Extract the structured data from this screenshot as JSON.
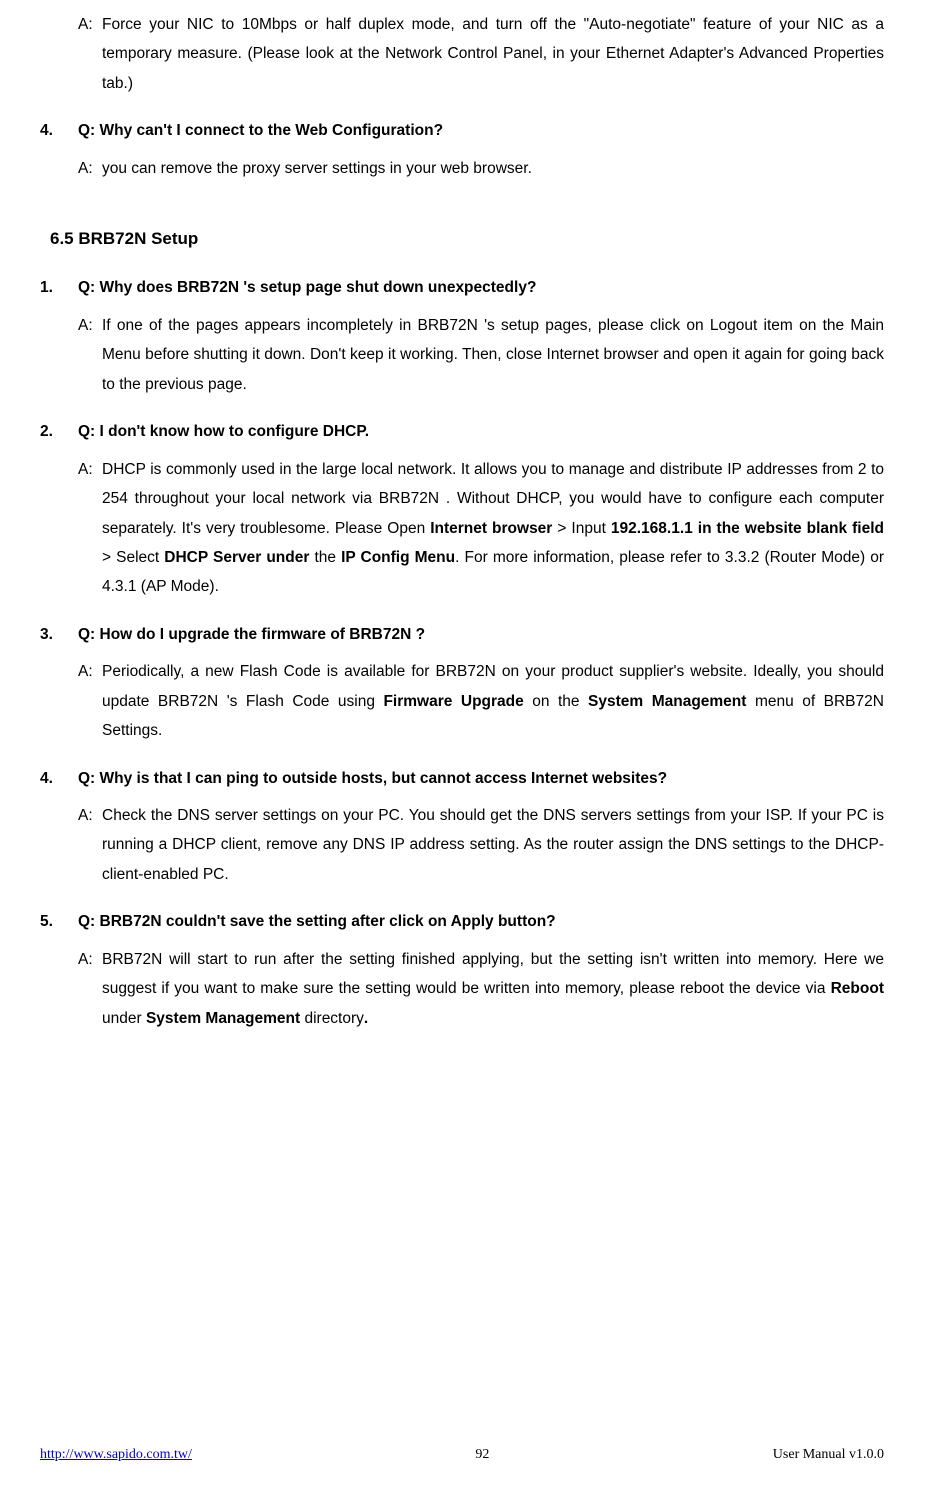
{
  "top": {
    "a_prefix": "A:",
    "a_text": "Force your NIC to 10Mbps or half duplex mode, and turn off the \"Auto-negotiate\" feature of your NIC as a temporary measure. (Please look at the Network Control Panel, in your Ethernet Adapter's Advanced Properties tab.)"
  },
  "q_top4": {
    "num": "4.",
    "q": "Q: Why can't I connect to the Web Configuration?",
    "a_prefix": "A:",
    "a_text": "you can remove the proxy server settings in your web browser."
  },
  "section": "6.5   BRB72N Setup",
  "q1": {
    "num": "1.",
    "q": "Q: Why does BRB72N 's setup page shut down unexpectedly?",
    "a_prefix": "A:",
    "a_text": "If one of the pages appears incompletely in BRB72N 's setup pages, please click on Logout item on the Main Menu before shutting it down. Don't keep it working. Then, close Internet browser and open it again for going back to the previous page."
  },
  "q2": {
    "num": "2.",
    "q": "Q:    I don't know how to configure DHCP.",
    "a_prefix": "A:",
    "a_pre": "DHCP is commonly used in the large local network. It allows you to manage and distribute IP addresses from 2 to 254 throughout your local network via BRB72N . Without DHCP, you would have to configure each computer separately. It's very troublesome. Please Open ",
    "a_b1": "Internet browser",
    "a_mid1": " > Input ",
    "a_b2": "192.168.1.1 in the website blank field",
    "a_mid2": " > Select ",
    "a_b3": "DHCP Server under",
    "a_mid3": " the ",
    "a_b4": "IP Config Menu",
    "a_post": ". For more information, please refer to 3.3.2 (Router Mode) or 4.3.1 (AP Mode)."
  },
  "q3": {
    "num": "3.",
    "q": "Q: How do I upgrade the firmware of BRB72N ?",
    "a_prefix": "A:",
    "a_pre": "Periodically, a new Flash Code is available for BRB72N on your product supplier's website. Ideally, you should update BRB72N 's Flash Code using ",
    "a_b1": "Firmware Upgrade",
    "a_mid1": " on the ",
    "a_b2": "System Management",
    "a_post": " menu of BRB72N Settings."
  },
  "q4": {
    "num": "4.",
    "q": "Q: Why is that I can ping to outside hosts, but cannot access Internet websites?",
    "a_prefix": "A:",
    "a_text": "Check the DNS server settings on your PC. You should get the DNS servers settings from your ISP. If your PC is running a DHCP client, remove any DNS IP address setting. As the router assign the DNS settings to the DHCP-client-enabled PC."
  },
  "q5": {
    "num": "5.",
    "q": "Q: BRB72N couldn't save the setting after click on Apply button?",
    "a_prefix": "A:",
    "a_pre": "BRB72N will start to run after the setting finished applying, but the setting isn't written into memory.    Here we suggest if you want to make sure the setting would be written into memory, please reboot the device via ",
    "a_b1": "Reboot",
    "a_mid1": " under ",
    "a_b2": "System Management",
    "a_post": " directory",
    "a_b3": "."
  },
  "footer": {
    "url": "http://www.sapido.com.tw/",
    "page": "92",
    "version": "User Manual v1.0.0"
  }
}
